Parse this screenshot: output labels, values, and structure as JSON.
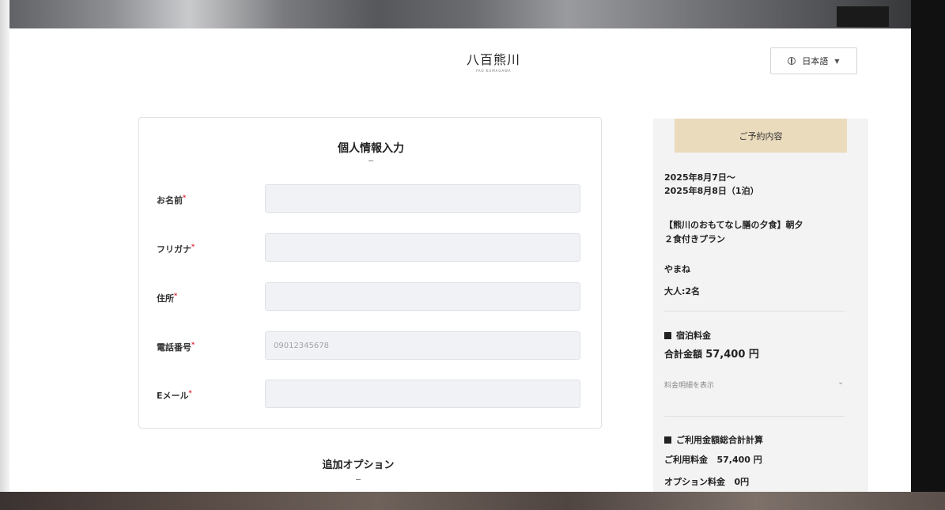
{
  "header": {
    "logo_main": "八百熊川",
    "logo_sub": "YAO KUMAGAWA",
    "language_label": "日本語"
  },
  "form": {
    "title": "個人情報入力",
    "fields": [
      {
        "label": "お名前",
        "value": "",
        "placeholder": ""
      },
      {
        "label": "フリガナ",
        "value": "",
        "placeholder": ""
      },
      {
        "label": "住所",
        "value": "",
        "placeholder": ""
      },
      {
        "label": "電話番号",
        "value": "",
        "placeholder": "09012345678"
      },
      {
        "label": "Eメール",
        "value": "",
        "placeholder": ""
      }
    ],
    "required_mark": "*"
  },
  "options": {
    "title": "追加オプション"
  },
  "summary": {
    "heading": "ご予約内容",
    "date_from": "2025年8月7日～",
    "date_to": "2025年8月8日（1泊）",
    "plan_line1": "【熊川のおもてなし膳の夕食】朝夕",
    "plan_line2": "２食付きプラン",
    "room": "やまね",
    "guests": "大人:2名",
    "lodging_title": "宿泊料金",
    "total_label": "合計金額",
    "total_value": "57,400 円",
    "details_link": "料金明細を表示",
    "grand_title": "ご利用金額総合計計算",
    "usage_label": "ご利用料金",
    "usage_value": "57,400 円",
    "option_label": "オプション料金",
    "option_value": "0円"
  },
  "icons": [
    "globe-icon",
    "caret-down-icon",
    "chevron-down-icon",
    "square-bullet-icon"
  ],
  "colors": {
    "accent_tan": "#eadbbd",
    "panel_bg": "#f3f3f3",
    "field_bg": "#f1f2f5",
    "required_red": "#dd2233"
  }
}
